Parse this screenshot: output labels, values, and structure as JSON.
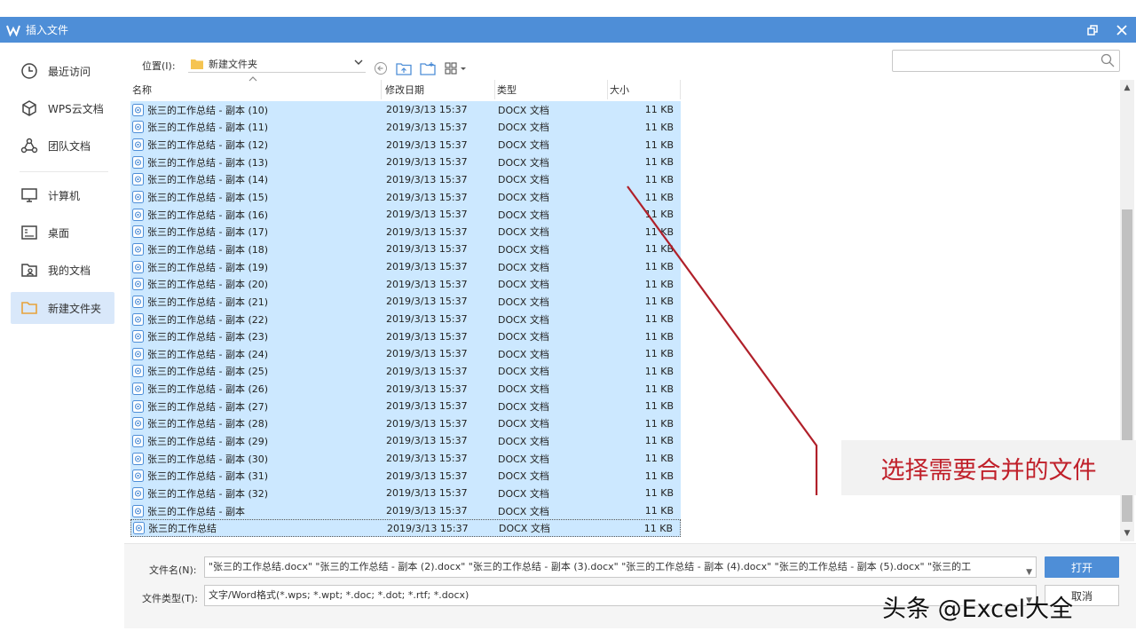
{
  "window": {
    "title": "插入文件",
    "restore_icon": "restore-icon",
    "close_icon": "close-icon"
  },
  "sidebar": {
    "items": [
      {
        "label": "最近访问",
        "icon": "clock-icon"
      },
      {
        "label": "WPS云文档",
        "icon": "cube-icon"
      },
      {
        "label": "团队文档",
        "icon": "team-icon"
      },
      {
        "label": "计算机",
        "icon": "monitor-icon"
      },
      {
        "label": "桌面",
        "icon": "desktop-icon"
      },
      {
        "label": "我的文档",
        "icon": "my-docs-icon"
      },
      {
        "label": "新建文件夹",
        "icon": "folder-icon"
      }
    ],
    "active_index": 6,
    "accent": "#d9e8fa"
  },
  "location": {
    "label": "位置(I):",
    "value": "新建文件夹"
  },
  "search": {
    "placeholder": ""
  },
  "columns": {
    "name": "名称",
    "date": "修改日期",
    "type": "类型",
    "size": "大小"
  },
  "files": [
    {
      "name": "张三的工作总结 - 副本 (10)",
      "date": "2019/3/13 15:37",
      "type": "DOCX 文档",
      "size": "11 KB"
    },
    {
      "name": "张三的工作总结 - 副本 (11)",
      "date": "2019/3/13 15:37",
      "type": "DOCX 文档",
      "size": "11 KB"
    },
    {
      "name": "张三的工作总结 - 副本 (12)",
      "date": "2019/3/13 15:37",
      "type": "DOCX 文档",
      "size": "11 KB"
    },
    {
      "name": "张三的工作总结 - 副本 (13)",
      "date": "2019/3/13 15:37",
      "type": "DOCX 文档",
      "size": "11 KB"
    },
    {
      "name": "张三的工作总结 - 副本 (14)",
      "date": "2019/3/13 15:37",
      "type": "DOCX 文档",
      "size": "11 KB"
    },
    {
      "name": "张三的工作总结 - 副本 (15)",
      "date": "2019/3/13 15:37",
      "type": "DOCX 文档",
      "size": "11 KB"
    },
    {
      "name": "张三的工作总结 - 副本 (16)",
      "date": "2019/3/13 15:37",
      "type": "DOCX 文档",
      "size": "11 KB"
    },
    {
      "name": "张三的工作总结 - 副本 (17)",
      "date": "2019/3/13 15:37",
      "type": "DOCX 文档",
      "size": "11 KB"
    },
    {
      "name": "张三的工作总结 - 副本 (18)",
      "date": "2019/3/13 15:37",
      "type": "DOCX 文档",
      "size": "11 KB"
    },
    {
      "name": "张三的工作总结 - 副本 (19)",
      "date": "2019/3/13 15:37",
      "type": "DOCX 文档",
      "size": "11 KB"
    },
    {
      "name": "张三的工作总结 - 副本 (20)",
      "date": "2019/3/13 15:37",
      "type": "DOCX 文档",
      "size": "11 KB"
    },
    {
      "name": "张三的工作总结 - 副本 (21)",
      "date": "2019/3/13 15:37",
      "type": "DOCX 文档",
      "size": "11 KB"
    },
    {
      "name": "张三的工作总结 - 副本 (22)",
      "date": "2019/3/13 15:37",
      "type": "DOCX 文档",
      "size": "11 KB"
    },
    {
      "name": "张三的工作总结 - 副本 (23)",
      "date": "2019/3/13 15:37",
      "type": "DOCX 文档",
      "size": "11 KB"
    },
    {
      "name": "张三的工作总结 - 副本 (24)",
      "date": "2019/3/13 15:37",
      "type": "DOCX 文档",
      "size": "11 KB"
    },
    {
      "name": "张三的工作总结 - 副本 (25)",
      "date": "2019/3/13 15:37",
      "type": "DOCX 文档",
      "size": "11 KB"
    },
    {
      "name": "张三的工作总结 - 副本 (26)",
      "date": "2019/3/13 15:37",
      "type": "DOCX 文档",
      "size": "11 KB"
    },
    {
      "name": "张三的工作总结 - 副本 (27)",
      "date": "2019/3/13 15:37",
      "type": "DOCX 文档",
      "size": "11 KB"
    },
    {
      "name": "张三的工作总结 - 副本 (28)",
      "date": "2019/3/13 15:37",
      "type": "DOCX 文档",
      "size": "11 KB"
    },
    {
      "name": "张三的工作总结 - 副本 (29)",
      "date": "2019/3/13 15:37",
      "type": "DOCX 文档",
      "size": "11 KB"
    },
    {
      "name": "张三的工作总结 - 副本 (30)",
      "date": "2019/3/13 15:37",
      "type": "DOCX 文档",
      "size": "11 KB"
    },
    {
      "name": "张三的工作总结 - 副本 (31)",
      "date": "2019/3/13 15:37",
      "type": "DOCX 文档",
      "size": "11 KB"
    },
    {
      "name": "张三的工作总结 - 副本 (32)",
      "date": "2019/3/13 15:37",
      "type": "DOCX 文档",
      "size": "11 KB"
    },
    {
      "name": "张三的工作总结 - 副本",
      "date": "2019/3/13 15:37",
      "type": "DOCX 文档",
      "size": "11 KB"
    },
    {
      "name": "张三的工作总结",
      "date": "2019/3/13 15:37",
      "type": "DOCX 文档",
      "size": "11 KB"
    }
  ],
  "file_icon": "docx-file-icon",
  "selection_color": "#cce8ff",
  "bottom": {
    "filename_label": "文件名(N):",
    "filename_value": "\"张三的工作总结.docx\" \"张三的工作总结 - 副本 (2).docx\" \"张三的工作总结 - 副本 (3).docx\" \"张三的工作总结 - 副本 (4).docx\" \"张三的工作总结 - 副本 (5).docx\" \"张三的工",
    "filetype_label": "文件类型(T):",
    "filetype_value": "文字/Word格式(*.wps; *.wpt; *.doc; *.dot; *.rtf; *.docx)",
    "open_label": "打开",
    "cancel_label": "取消"
  },
  "annotation": {
    "callout_text": "选择需要合并的文件",
    "callout_color": "#c0202a"
  },
  "watermark": "头条 @Excel大全"
}
